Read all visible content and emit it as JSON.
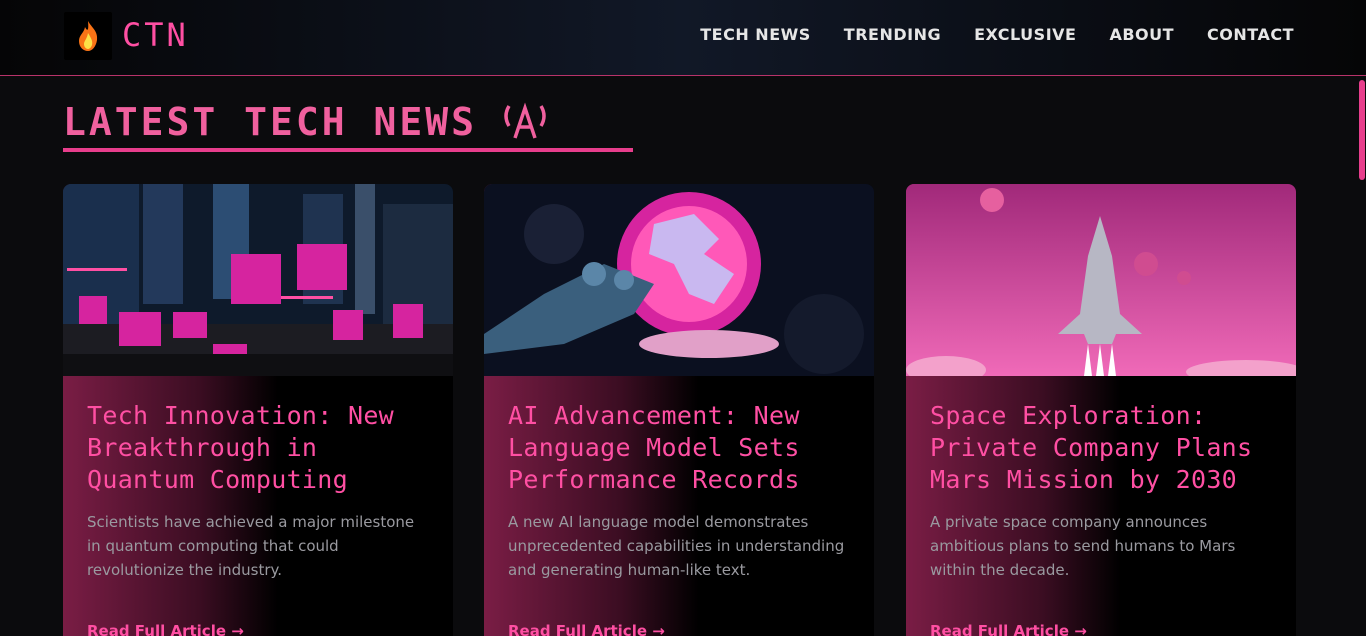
{
  "header": {
    "brand": "CTN",
    "logo_icon": "flame-icon",
    "nav": [
      "TECH NEWS",
      "TRENDING",
      "EXCLUSIVE",
      "ABOUT",
      "CONTACT"
    ]
  },
  "section": {
    "title": "LATEST TECH NEWS",
    "icon": "antenna-icon"
  },
  "articles": [
    {
      "title": "Tech Innovation: New Breakthrough in Quantum Computing",
      "summary": "Scientists have achieved a major milestone in quantum computing that could revolutionize the industry.",
      "link": "Read Full Article →",
      "image": "protest-crowd-city-night"
    },
    {
      "title": "AI Advancement: New Language Model Sets Performance Records",
      "summary": "A new AI language model demonstrates unprecedented capabilities in understanding and generating human-like text.",
      "link": "Read Full Article →",
      "image": "robot-hand-globe"
    },
    {
      "title": "Space Exploration: Private Company Plans Mars Mission by 2030",
      "summary": "A private space company announces ambitious plans to send humans to Mars within the decade.",
      "link": "Read Full Article →",
      "image": "rocket-launch-pink-sky"
    }
  ],
  "colors": {
    "accent": "#ff4fa3",
    "background": "#0b0b0d"
  }
}
